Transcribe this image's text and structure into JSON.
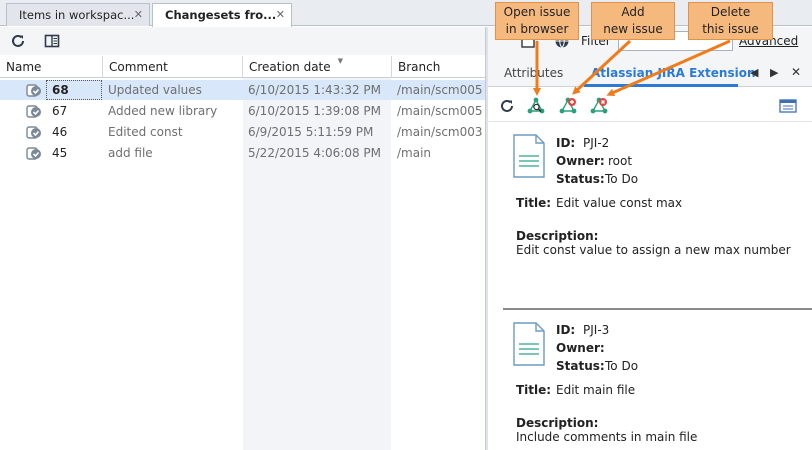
{
  "tabs": [
    {
      "label": "Items in workspac...",
      "active": false
    },
    {
      "label": "Changesets fro...",
      "active": true
    }
  ],
  "changesets": {
    "columns": [
      "Name",
      "Comment",
      "Creation date",
      "Branch"
    ],
    "rows": [
      {
        "name": "68",
        "comment": "Updated values",
        "date": "6/10/2015 1:43:32 PM",
        "branch": "/main/scm005",
        "selected": true
      },
      {
        "name": "67",
        "comment": "Added new library",
        "date": "6/10/2015 1:39:08 PM",
        "branch": "/main/scm005",
        "selected": false
      },
      {
        "name": "46",
        "comment": "Edited const",
        "date": "6/9/2015 5:11:59 PM",
        "branch": "/main/scm003",
        "selected": false
      },
      {
        "name": "45",
        "comment": "add file",
        "date": "5/22/2015 4:06:08 PM",
        "branch": "/main",
        "selected": false
      }
    ]
  },
  "filter": {
    "label": "Filter",
    "value": "",
    "advanced_label": "Advanced"
  },
  "right_tabs": [
    {
      "label": "Attributes",
      "active": false
    },
    {
      "label": "Atlassian JIRA Extension",
      "active": true
    }
  ],
  "issues": [
    {
      "id_label": "ID:",
      "id": "PJI-2",
      "owner_label": "Owner:",
      "owner": "root",
      "status_label": "Status:",
      "status": "To Do",
      "title_label": "Title:",
      "title": "Edit value const max",
      "description_label": "Description:",
      "description": "Edit const value to assign a new max number"
    },
    {
      "id_label": "ID:",
      "id": "PJI-3",
      "owner_label": "Owner:",
      "owner": "",
      "status_label": "Status:",
      "status": "To Do",
      "title_label": "Title:",
      "title": "Edit main file",
      "description_label": "Description:",
      "description": "Include comments in main file"
    }
  ],
  "callouts": [
    {
      "line1": "Open issue",
      "line2": "in browser"
    },
    {
      "line1": "Add",
      "line2": "new issue"
    },
    {
      "line1": "Delete",
      "line2": "this issue"
    }
  ],
  "icons": {
    "refresh": "refresh-icon",
    "split_view": "split-view-icon",
    "changeset": "changeset-icon",
    "open_issue": "open-issue-in-browser-icon",
    "add_issue": "add-issue-icon",
    "delete_issue": "delete-issue-icon",
    "view_options": "view-options-icon",
    "document": "issue-document-icon"
  },
  "colors": {
    "accent_blue": "#2b7bd6",
    "selection": "#d8e8fa",
    "callout_fill": "#f5b87d",
    "arrow_orange": "#f07b1b",
    "jira_green": "#2aa17a",
    "jira_red": "#e2463f"
  }
}
